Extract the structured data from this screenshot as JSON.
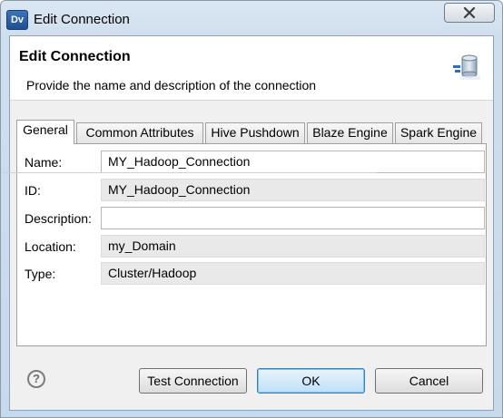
{
  "window": {
    "title": "Edit Connection",
    "app_icon_text": "Dv"
  },
  "header": {
    "title": "Edit Connection",
    "description": "Provide the name and description of the connection",
    "icon": "database-connection-icon"
  },
  "tabs": [
    {
      "label": "General",
      "active": true
    },
    {
      "label": "Common Attributes",
      "active": false
    },
    {
      "label": "Hive Pushdown",
      "active": false
    },
    {
      "label": "Blaze Engine",
      "active": false
    },
    {
      "label": "Spark Engine",
      "active": false
    }
  ],
  "form": {
    "name": {
      "label": "Name:",
      "value": "MY_Hadoop_Connection"
    },
    "id": {
      "label": "ID:",
      "value": "MY_Hadoop_Connection"
    },
    "description": {
      "label": "Description:",
      "value": ""
    },
    "location": {
      "label": "Location:",
      "value": "my_Domain"
    },
    "type": {
      "label": "Type:",
      "value": "Cluster/Hadoop"
    }
  },
  "footer": {
    "help_symbol": "?",
    "test_connection_label": "Test Connection",
    "ok_label": "OK",
    "cancel_label": "Cancel"
  },
  "colors": {
    "title_bar": "#cfdeee",
    "default_button": "#bfe0f7",
    "readonly_field": "#e9e9e9"
  }
}
